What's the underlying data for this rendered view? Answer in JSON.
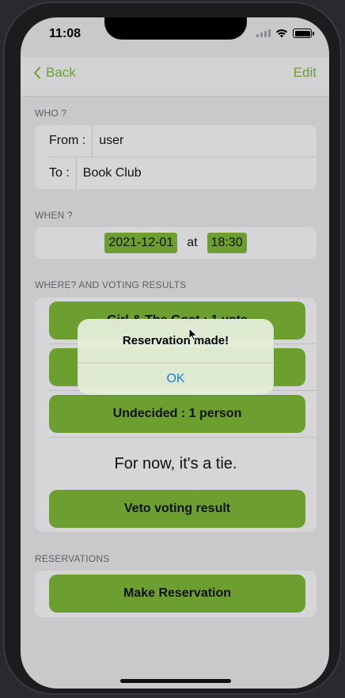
{
  "status": {
    "time": "11:08"
  },
  "nav": {
    "back_label": "Back",
    "edit_label": "Edit"
  },
  "who": {
    "section": "WHO ?",
    "from_label": "From :",
    "from_value": "user",
    "to_label": "To :",
    "to_value": "Book Club"
  },
  "when": {
    "section": "WHEN ?",
    "date": "2021-12-01",
    "at_label": "at",
    "time": "18:30"
  },
  "where": {
    "section": "WHERE? AND VOTING RESULTS",
    "options": [
      "Girl & The Goat : 1 vote",
      "",
      "Undecided : 1 person"
    ],
    "tie_text": "For now, it's a tie.",
    "veto_label": "Veto voting result"
  },
  "reservations": {
    "section": "RESERVATIONS",
    "make_label": "Make Reservation"
  },
  "alert": {
    "title": "Reservation made!",
    "ok_label": "OK"
  },
  "colors": {
    "accent": "#6d9e30",
    "alert_button": "#1a7fe0"
  }
}
